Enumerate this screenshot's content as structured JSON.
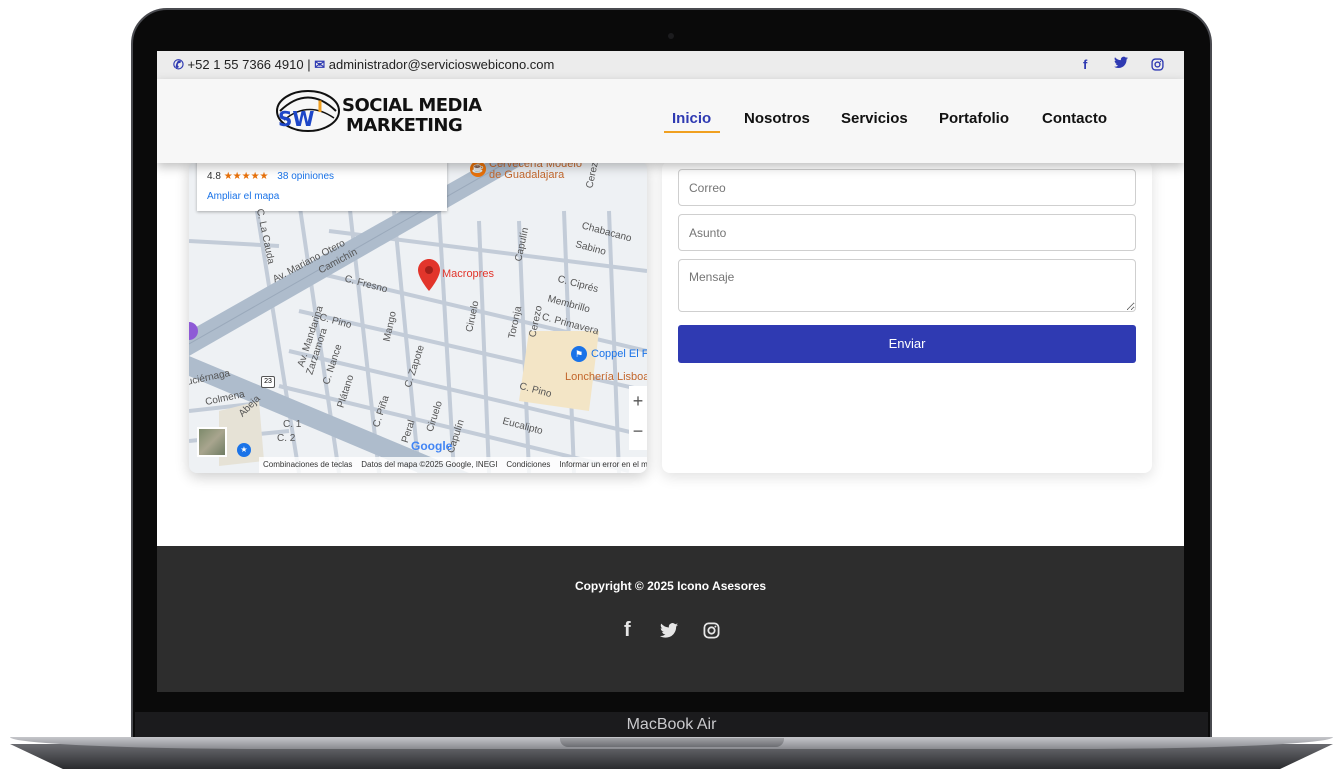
{
  "device": {
    "label": "MacBook Air"
  },
  "topbar": {
    "phone": "+52 1 55 7366 4910",
    "separator": "|",
    "email": "administrador@servicioswebicono.com",
    "social_icons": [
      "facebook-icon",
      "twitter-icon",
      "instagram-icon"
    ]
  },
  "header": {
    "logo_line1": "SOCIAL MEDIA",
    "logo_line2": "MARKETING",
    "logo_mark": "SWI",
    "nav": [
      "Inicio",
      "Nosotros",
      "Servicios",
      "Portafolio",
      "Contacto"
    ],
    "active_nav": "Inicio"
  },
  "map": {
    "rating": "4.8",
    "stars": "★★★★★",
    "reviews": "38 opiniones",
    "expand_link": "Ampliar el mapa",
    "place_name": "Macropres",
    "poi_1": "Cervecería Modelo",
    "poi_1b": "de Guadalajara",
    "poi_2": "Coppel El F",
    "poi_3": "Lonchería Lisboa",
    "google": "Google",
    "attribution": [
      "Combinaciones de teclas",
      "Datos del mapa ©2025 Google, INEGI",
      "Condiciones",
      "Informar un error en el m"
    ],
    "streets": [
      "Av. Mariano Otero",
      "C. Fresno",
      "Camichín",
      "C. Pino",
      "Mango",
      "Ciruelo",
      "Capulín",
      "Toronja",
      "Cerezo",
      "C. Primavera",
      "Membrillo",
      "C. Ciprés",
      "Chabacano",
      "Sabino",
      "Av. Mandarina",
      "Zarzamora",
      "C. Nance",
      "C. Zapote",
      "Plátano",
      "C. Piña",
      "Peral",
      "Ciruelo",
      "Capulín",
      "Eucalipto",
      "C. Pino",
      "Colmena",
      "Abeja",
      "Luciérnaga",
      "C. 1",
      "C. 2",
      "C. La Cauda",
      "Cerezo"
    ],
    "route_shield": "23"
  },
  "form": {
    "email_placeholder": "Correo",
    "subject_placeholder": "Asunto",
    "message_placeholder": "Mensaje",
    "submit_label": "Enviar"
  },
  "footer": {
    "copyright": "Copyright © 2025 Icono Asesores",
    "social_icons": [
      "facebook-icon",
      "twitter-icon",
      "instagram-icon"
    ]
  },
  "colors": {
    "accent": "#2f3ab2",
    "underline": "#f0a020",
    "footer_bg": "#2d2d2d",
    "pin": "#e2352b"
  }
}
